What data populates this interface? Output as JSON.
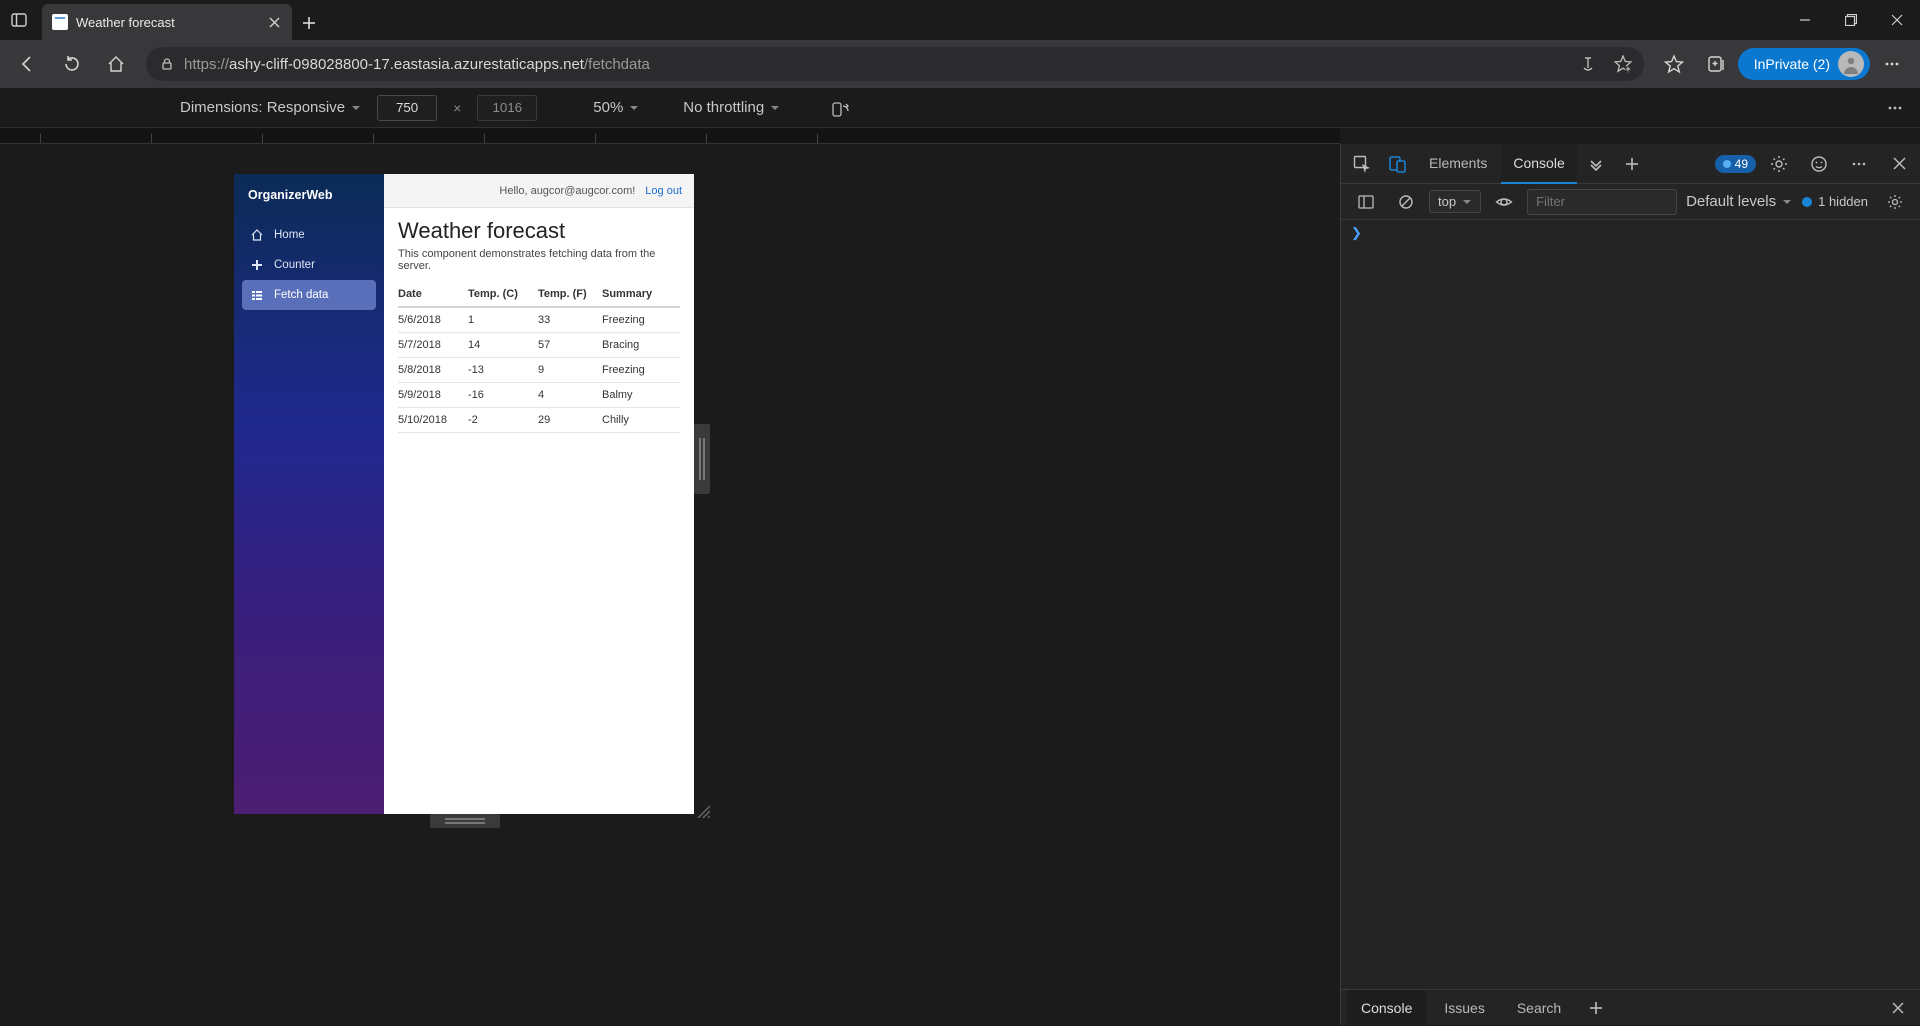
{
  "browser": {
    "tab_title": "Weather forecast",
    "url_prefix": "https://",
    "url_host": "ashy-cliff-098028800-17.eastasia.azurestaticapps.net",
    "url_path": "/fetchdata",
    "inprivate_label": "InPrivate (2)"
  },
  "device_toolbar": {
    "dimensions_label": "Dimensions: Responsive",
    "width": "750",
    "height": "1016",
    "zoom": "50%",
    "throttling": "No throttling"
  },
  "devtools": {
    "tabs": {
      "elements": "Elements",
      "console": "Console"
    },
    "issue_count": "49",
    "filter_placeholder": "Filter",
    "context": "top",
    "levels": "Default levels",
    "hidden_label": "1 hidden",
    "drawer": {
      "console": "Console",
      "issues": "Issues",
      "search": "Search"
    }
  },
  "app": {
    "brand": "OrganizerWeb",
    "nav": {
      "home": "Home",
      "counter": "Counter",
      "fetch": "Fetch data"
    },
    "greeting": "Hello, augcor@augcor.com!",
    "logout": "Log out",
    "page_title": "Weather forecast",
    "page_subtitle": "This component demonstrates fetching data from the server.",
    "columns": {
      "date": "Date",
      "tc": "Temp. (C)",
      "tf": "Temp. (F)",
      "summary": "Summary"
    },
    "rows": [
      {
        "date": "5/6/2018",
        "tc": "1",
        "tf": "33",
        "summary": "Freezing"
      },
      {
        "date": "5/7/2018",
        "tc": "14",
        "tf": "57",
        "summary": "Bracing"
      },
      {
        "date": "5/8/2018",
        "tc": "-13",
        "tf": "9",
        "summary": "Freezing"
      },
      {
        "date": "5/9/2018",
        "tc": "-16",
        "tf": "4",
        "summary": "Balmy"
      },
      {
        "date": "5/10/2018",
        "tc": "-2",
        "tf": "29",
        "summary": "Chilly"
      }
    ]
  }
}
